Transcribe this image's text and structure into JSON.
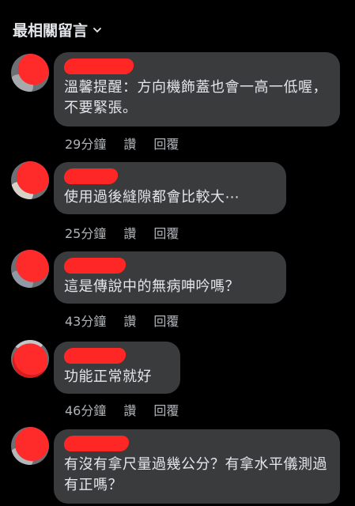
{
  "header": {
    "title": "最相關留言"
  },
  "comments": [
    {
      "text": "溫馨提醒：方向機飾蓋也會一高一低喔，不要緊張。",
      "time": "29分鐘",
      "like": "讚",
      "reply": "回覆"
    },
    {
      "text": "使用過後縫隙都會比較大⋯",
      "time": "25分鐘",
      "like": "讚",
      "reply": "回覆"
    },
    {
      "text": "這是傳說中的無病呻吟嗎？",
      "time": "43分鐘",
      "like": "讚",
      "reply": "回覆"
    },
    {
      "text": "功能正常就好",
      "time": "46分鐘",
      "like": "讚",
      "reply": "回覆"
    },
    {
      "text": "有沒有拿尺量過幾公分？有拿水平儀測過有正嗎？",
      "time": "",
      "like": "",
      "reply": ""
    }
  ],
  "colors": {
    "background": "#000000",
    "bubble": "#3a3b3c",
    "text": "#e4e6eb",
    "meta": "#b0b3b8",
    "redaction": "#ff2626"
  }
}
